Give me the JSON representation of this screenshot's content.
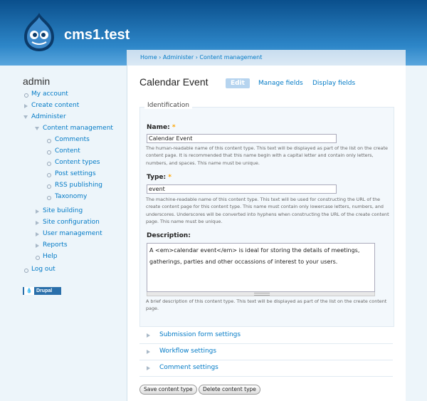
{
  "site": {
    "name": "cms1.test"
  },
  "sidebar": {
    "user": "admin",
    "items": [
      {
        "label": "My account"
      },
      {
        "label": "Create content"
      },
      {
        "label": "Administer"
      },
      {
        "label": "Content management"
      },
      {
        "label": "Comments"
      },
      {
        "label": "Content"
      },
      {
        "label": "Content types"
      },
      {
        "label": "Post settings"
      },
      {
        "label": "RSS publishing"
      },
      {
        "label": "Taxonomy"
      },
      {
        "label": "Site building"
      },
      {
        "label": "Site configuration"
      },
      {
        "label": "User management"
      },
      {
        "label": "Reports"
      },
      {
        "label": "Help"
      },
      {
        "label": "Log out"
      }
    ],
    "badge": {
      "mark": "💧",
      "text": "Drupal"
    }
  },
  "breadcrumb": "Home › Administer › Content management",
  "page": {
    "title": "Calendar Event"
  },
  "tabs": [
    {
      "label": "Edit"
    },
    {
      "label": "Manage fields"
    },
    {
      "label": "Display fields"
    }
  ],
  "form": {
    "legend": "Identification",
    "name": {
      "label": "Name:",
      "required_mark": "*",
      "value": "Calendar Event",
      "description": "The human-readable name of this content type. This text will be displayed as part of the list on the create content page. It is recommended that this name begin with a capital letter and contain only letters, numbers, and spaces. This name must be unique."
    },
    "type": {
      "label": "Type:",
      "required_mark": "*",
      "value": "event",
      "description": "The machine-readable name of this content type. This text will be used for constructing the URL of the create content page for this content type. This name must contain only lowercase letters, numbers, and underscores. Underscores will be converted into hyphens when constructing the URL of the create content page. This name must be unique."
    },
    "description": {
      "label": "Description:",
      "value": "A <em>calendar event</em> is ideal for storing the details of meetings, gatherings, parties and other occassions of interest to your users.",
      "help": "A brief description of this content type. This text will be displayed as part of the list on the create content page."
    }
  },
  "collapsibles": [
    {
      "label": "Submission form settings"
    },
    {
      "label": "Workflow settings"
    },
    {
      "label": "Comment settings"
    }
  ],
  "buttons": {
    "save": "Save content type",
    "delete": "Delete content type"
  },
  "colors": {
    "link": "#027ac6",
    "required": "#ffa500",
    "header": "#0a4f8c"
  }
}
